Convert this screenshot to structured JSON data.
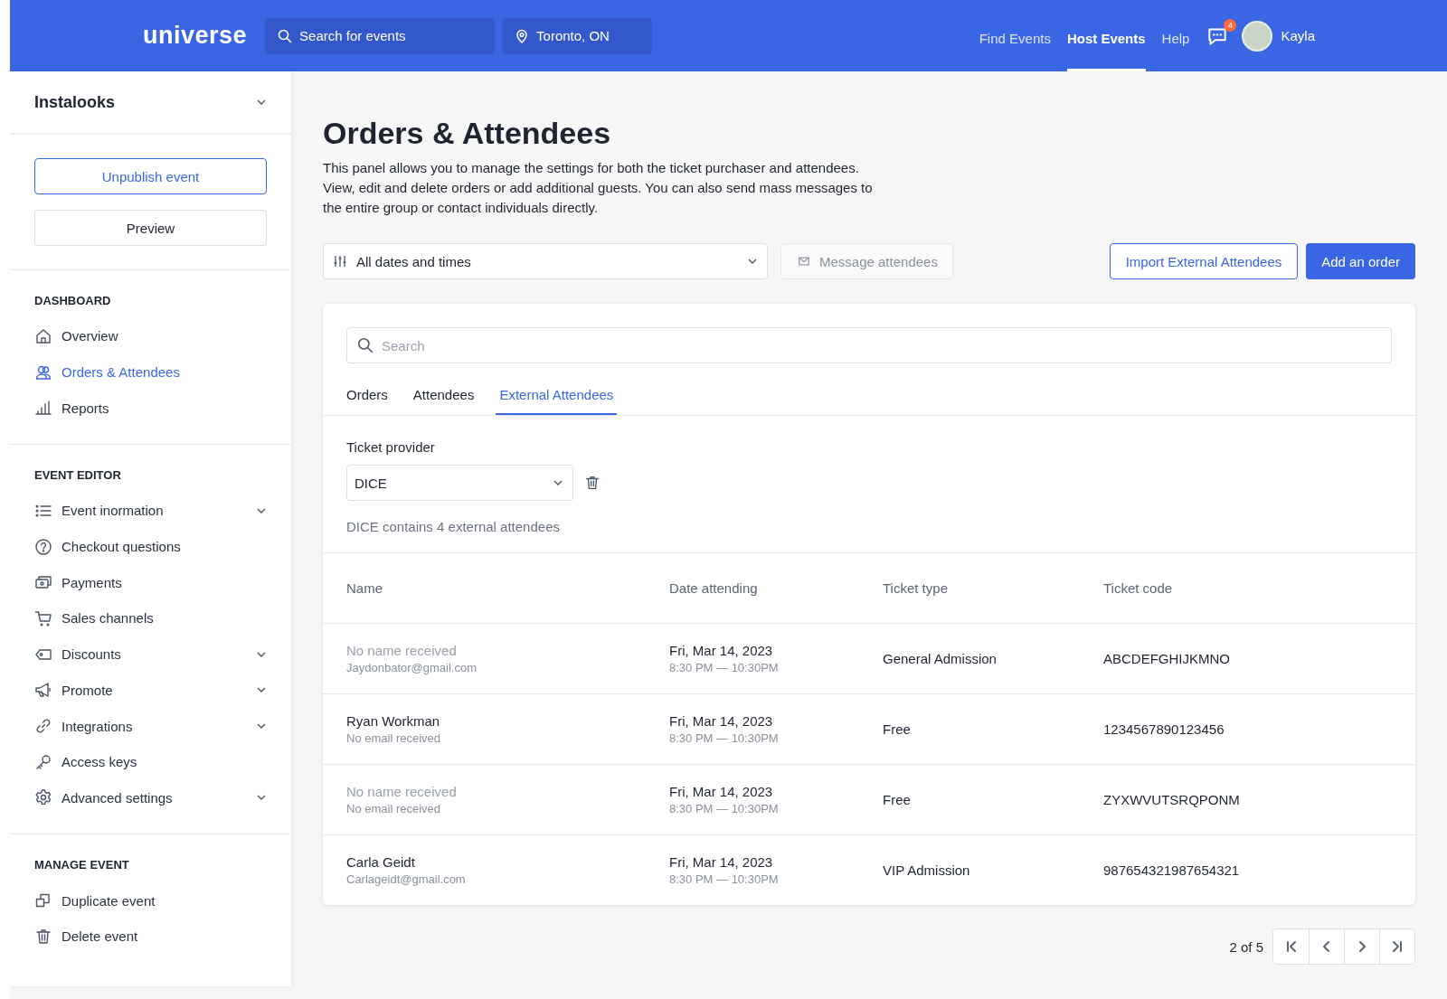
{
  "header": {
    "logo": "universe",
    "search": {
      "placeholder": "Search for events"
    },
    "location": {
      "value": "Toronto, ON"
    },
    "nav": [
      {
        "label": "Find Events",
        "selected": false
      },
      {
        "label": "Host Events",
        "selected": true
      },
      {
        "label": "Help",
        "selected": false
      }
    ],
    "notification_count": "4",
    "user": {
      "name": "Kayla"
    }
  },
  "sidebar": {
    "event": "Instalooks",
    "buttons": [
      {
        "label": "Unpublish event",
        "kind": "primary"
      },
      {
        "label": "Preview",
        "kind": "secondary"
      }
    ],
    "sections": [
      {
        "heading": "DASHBOARD",
        "items": [
          {
            "label": "Overview",
            "selected": false,
            "expandable": false
          },
          {
            "label": "Orders & Attendees",
            "selected": true,
            "expandable": false
          },
          {
            "label": "Reports",
            "selected": false,
            "expandable": false
          }
        ]
      },
      {
        "heading": "EVENT EDITOR",
        "items": [
          {
            "label": "Event inormation",
            "selected": false,
            "expandable": true
          },
          {
            "label": "Checkout questions",
            "selected": false,
            "expandable": false
          },
          {
            "label": "Payments",
            "selected": false,
            "expandable": false
          },
          {
            "label": "Sales channels",
            "selected": false,
            "expandable": false
          },
          {
            "label": "Discounts",
            "selected": false,
            "expandable": true
          },
          {
            "label": "Promote",
            "selected": false,
            "expandable": true
          },
          {
            "label": "Integrations",
            "selected": false,
            "expandable": true
          },
          {
            "label": "Access keys",
            "selected": false,
            "expandable": false
          },
          {
            "label": "Advanced settings",
            "selected": false,
            "expandable": true
          }
        ]
      },
      {
        "heading": "MANAGE EVENT",
        "items": [
          {
            "label": "Duplicate event",
            "selected": false,
            "expandable": false
          },
          {
            "label": "Delete event",
            "selected": false,
            "expandable": false
          }
        ]
      }
    ]
  },
  "page": {
    "title": "Orders & Attendees",
    "description": "This panel allows you to manage the settings for both the ticket purchaser and attendees. View, edit and delete orders or add additional guests. You can also send mass messages to the entire group or contact individuals directly.",
    "date_filter": {
      "value": "All dates and times"
    },
    "message_button": {
      "label": "Message attendees",
      "disabled": true
    },
    "import_button": "Import External Attendees",
    "add_button": "Add an order"
  },
  "panel": {
    "search": {
      "placeholder": "Search"
    },
    "tabs": [
      {
        "label": "Orders",
        "selected": false
      },
      {
        "label": "Attendees",
        "selected": false
      },
      {
        "label": "External Attendees",
        "selected": true
      }
    ],
    "provider_label": "Ticket provider",
    "provider": {
      "value": "DICE"
    },
    "provider_note": "DICE contains 4 external attendees",
    "table": {
      "columns": [
        "Name",
        "Date attending",
        "Ticket type",
        "Ticket code"
      ],
      "rows": [
        {
          "name": "No name received",
          "name_missing": true,
          "email": "Jaydonbator@gmail.com",
          "date": "Fri, Mar 14, 2023",
          "time": "8:30 PM — 10:30PM",
          "ticket_type": "General Admission",
          "ticket_code": "ABCDEFGHIJKMNO"
        },
        {
          "name": "Ryan Workman",
          "name_missing": false,
          "email": "No email received",
          "date": "Fri, Mar 14, 2023",
          "time": "8:30 PM — 10:30PM",
          "ticket_type": "Free",
          "ticket_code": "1234567890123456"
        },
        {
          "name": "No name received",
          "name_missing": true,
          "email": "No email received",
          "date": "Fri, Mar 14, 2023",
          "time": "8:30 PM — 10:30PM",
          "ticket_type": "Free",
          "ticket_code": "ZYXWVUTSRQPONM"
        },
        {
          "name": "Carla Geidt",
          "name_missing": false,
          "email": "Carlageidt@gmail.com",
          "date": "Fri, Mar 14, 2023",
          "time": "8:30 PM — 10:30PM",
          "ticket_type": "VIP Admission",
          "ticket_code": "987654321987654321"
        }
      ]
    }
  },
  "pagination": {
    "label": "2 of 5"
  }
}
